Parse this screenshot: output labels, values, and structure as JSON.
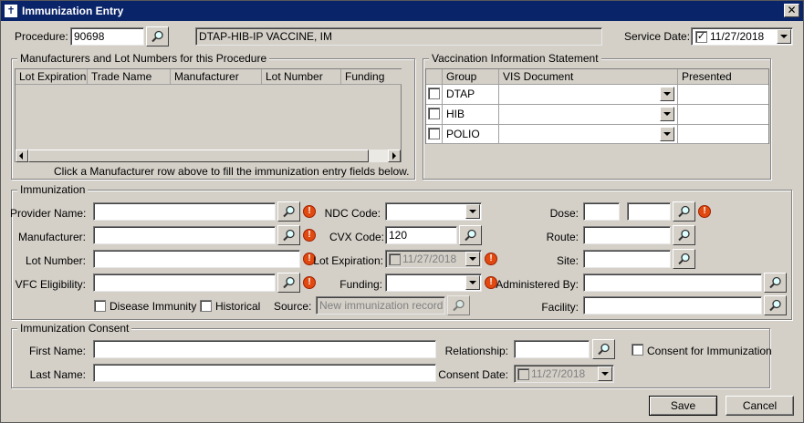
{
  "window": {
    "title": "Immunization Entry",
    "close": "✕"
  },
  "procedure": {
    "label": "Procedure:",
    "code": "90698",
    "description": "DTAP-HIB-IP VACCINE, IM"
  },
  "service_date": {
    "label": "Service Date:",
    "value": "11/27/2018",
    "checked": "✓"
  },
  "manufacturers": {
    "title": "Manufacturers and Lot Numbers for this Procedure",
    "columns": [
      "Lot Expiration",
      "Trade Name",
      "Manufacturer",
      "Lot Number",
      "Funding"
    ],
    "hint": "Click a Manufacturer row above to fill the immunization entry fields below."
  },
  "vis": {
    "title": "Vaccination Information Statement",
    "columns": [
      "Group",
      "VIS Document",
      "Presented"
    ],
    "rows": [
      {
        "group": "DTAP"
      },
      {
        "group": "HIB"
      },
      {
        "group": "POLIO"
      }
    ]
  },
  "immunization": {
    "title": "Immunization",
    "provider_name_label": "Provider Name:",
    "manufacturer_label": "Manufacturer:",
    "lot_number_label": "Lot Number:",
    "vfc_label": "VFC Eligibility:",
    "ndc_label": "NDC Code:",
    "cvx_label": "CVX Code:",
    "cvx_value": "120",
    "lot_exp_label": "Lot Expiration:",
    "lot_exp_value": "11/27/2018",
    "funding_label": "Funding:",
    "source_label": "Source:",
    "source_value": "New immunization record",
    "dose_label": "Dose:",
    "route_label": "Route:",
    "site_label": "Site:",
    "administered_label": "Administered By:",
    "facility_label": "Facility:",
    "disease_immunity_label": "Disease Immunity",
    "historical_label": "Historical",
    "warn_glyph": "!"
  },
  "consent": {
    "title": "Immunization Consent",
    "first_name_label": "First Name:",
    "last_name_label": "Last Name:",
    "relationship_label": "Relationship:",
    "consent_checkbox_label": "Consent for Immunization",
    "consent_date_label": "Consent Date:",
    "consent_date_value": "11/27/2018"
  },
  "buttons": {
    "save": "Save",
    "cancel": "Cancel"
  },
  "colors": {
    "title_bar": "#0a246a",
    "window_bg": "#d4d0c8",
    "warning": "#e04a10"
  }
}
